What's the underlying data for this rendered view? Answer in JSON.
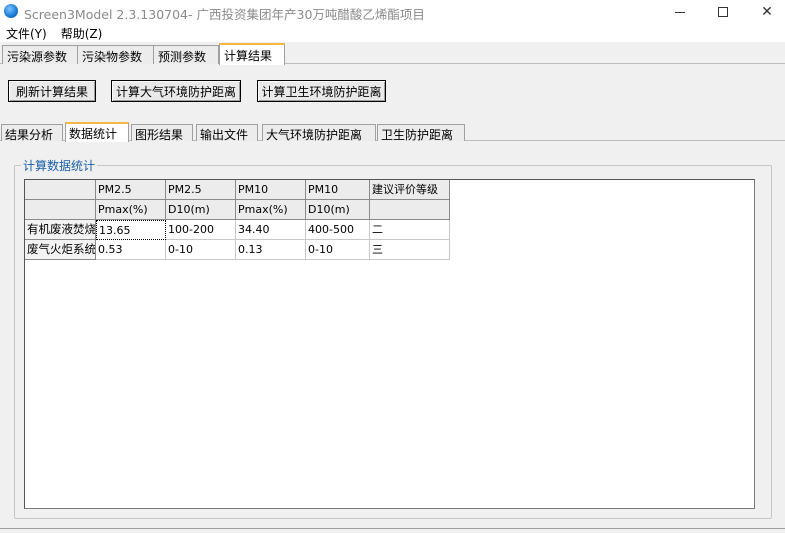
{
  "window": {
    "title": "Screen3Model 2.3.130704- 广西投资集团年产30万吨醋酸乙烯酯项目",
    "minimize": "—",
    "maximize": "",
    "close": "✕"
  },
  "menu": {
    "items": [
      "文件(Y)",
      "帮助(Z)"
    ]
  },
  "top_tabs": [
    {
      "label": "污染源参数",
      "active": false
    },
    {
      "label": "污染物参数",
      "active": false
    },
    {
      "label": "预测参数",
      "active": false
    },
    {
      "label": "计算结果",
      "active": true
    }
  ],
  "buttons": {
    "refresh": "刷新计算结果",
    "atmos_distance": "计算大气环境防护距离",
    "health_distance": "计算卫生环境防护距离"
  },
  "sub_tabs": [
    {
      "label": "结果分析",
      "active": false
    },
    {
      "label": "数据统计",
      "active": true
    },
    {
      "label": "图形结果",
      "active": false
    },
    {
      "label": "输出文件",
      "active": false
    },
    {
      "label": "大气环境防护距离",
      "active": false
    },
    {
      "label": "卫生防护距离",
      "active": false
    }
  ],
  "group": {
    "title": "计算数据统计"
  },
  "table": {
    "headers_row1": [
      "PM2.5",
      "PM2.5",
      "PM10",
      "PM10",
      "建议评价等级"
    ],
    "headers_row2": [
      "Pmax(%)",
      "D10(m)",
      "Pmax(%)",
      "D10(m)",
      ""
    ],
    "rows": [
      {
        "name": "有机废液焚烧",
        "values": [
          "13.65",
          "100-200",
          "34.40",
          "400-500",
          "二"
        ]
      },
      {
        "name": "废气火炬系统",
        "values": [
          "0.53",
          "0-10",
          "0.13",
          "0-10",
          "三"
        ]
      }
    ]
  }
}
